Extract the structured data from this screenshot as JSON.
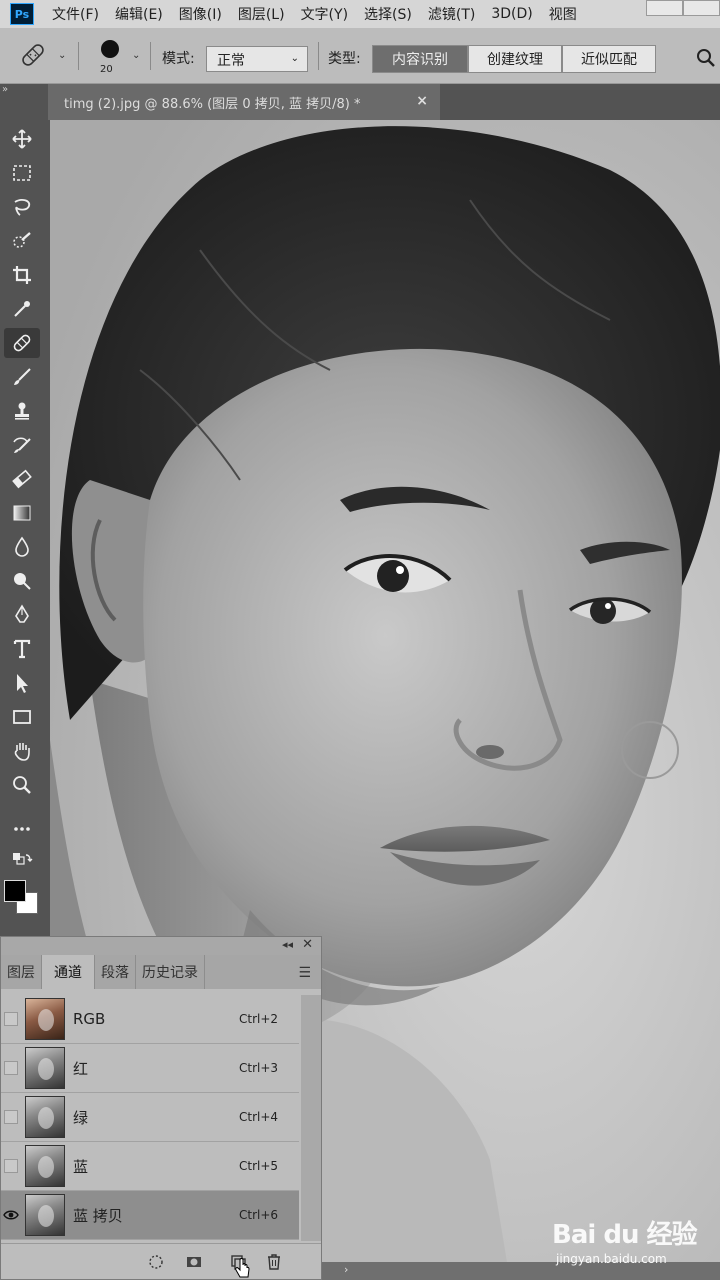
{
  "menu": [
    "文件(F)",
    "编辑(E)",
    "图像(I)",
    "图层(L)",
    "文字(Y)",
    "选择(S)",
    "滤镜(T)",
    "3D(D)",
    "视图"
  ],
  "options": {
    "brush_size": "20",
    "mode_label": "模式:",
    "mode_value": "正常",
    "type_label": "类型:",
    "type_buttons": [
      "内容识别",
      "创建纹理",
      "近似匹配"
    ],
    "active_type": "内容识别"
  },
  "document_tab": {
    "title": "timg (2).jpg @ 88.6% (图层 0 拷贝, 蓝 拷贝/8) *",
    "close": "×"
  },
  "tools": [
    "move-tool",
    "marquee-tool",
    "lasso-tool",
    "quick-select-tool",
    "crop-tool",
    "eyedropper-tool",
    "healing-brush-tool",
    "brush-tool",
    "clone-stamp-tool",
    "history-brush-tool",
    "eraser-tool",
    "gradient-tool",
    "blur-tool",
    "dodge-tool",
    "pen-tool",
    "type-tool",
    "path-select-tool",
    "rectangle-tool",
    "hand-tool",
    "zoom-tool",
    "more-tools"
  ],
  "active_tool": "healing-brush-tool",
  "colors": {
    "foreground": "#000000",
    "background": "#ffffff"
  },
  "panel": {
    "tabs": [
      "图层",
      "通道",
      "段落",
      "历史记录"
    ],
    "active_tab": "通道",
    "channels": [
      {
        "name": "RGB",
        "shortcut": "Ctrl+2",
        "visible": false,
        "selected": false
      },
      {
        "name": "红",
        "shortcut": "Ctrl+3",
        "visible": false,
        "selected": false
      },
      {
        "name": "绿",
        "shortcut": "Ctrl+4",
        "visible": false,
        "selected": false
      },
      {
        "name": "蓝",
        "shortcut": "Ctrl+5",
        "visible": false,
        "selected": false
      },
      {
        "name": "蓝 拷贝",
        "shortcut": "Ctrl+6",
        "visible": true,
        "selected": true
      }
    ]
  },
  "watermark": {
    "logo": "Bai du 经验",
    "url": "jingyan.baidu.com"
  }
}
